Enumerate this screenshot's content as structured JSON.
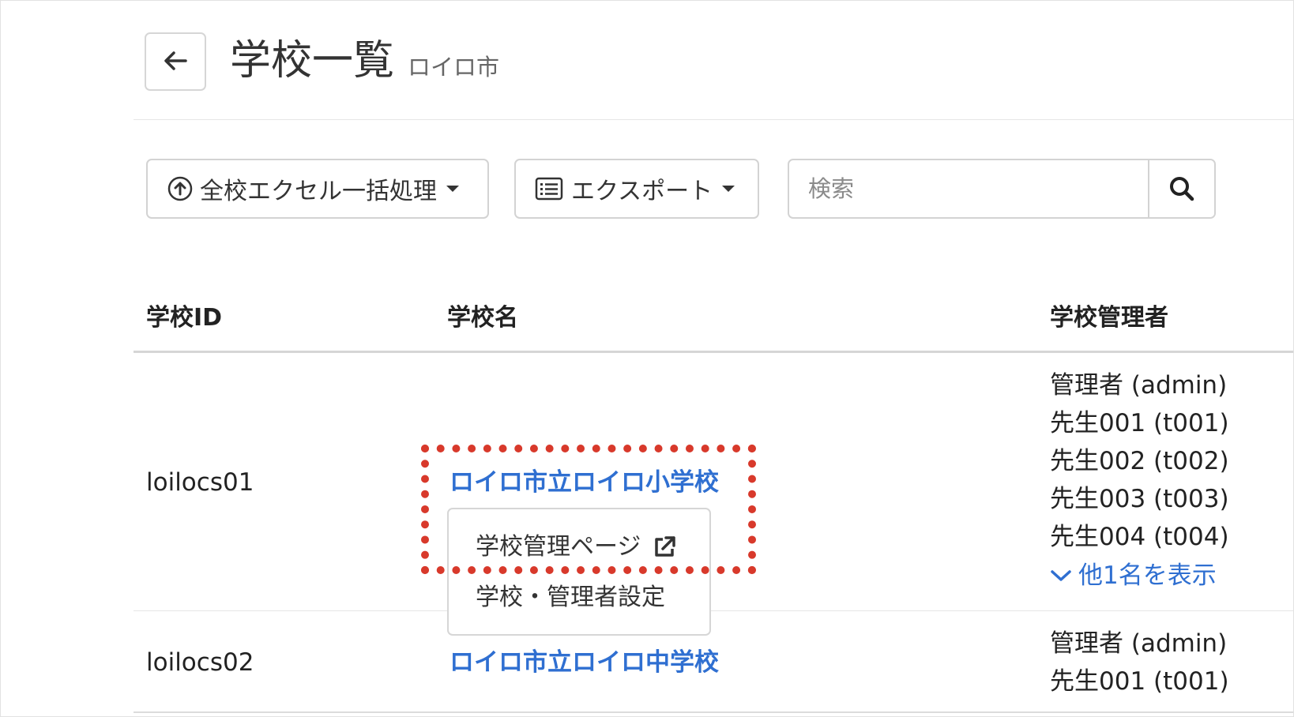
{
  "header": {
    "back_button_label": "",
    "title": "学校一覧",
    "subtitle": "ロイロ市"
  },
  "toolbar": {
    "bulk_excel_label": "全校エクセル一括処理",
    "export_label": "エクスポート",
    "search_placeholder": "検索"
  },
  "table": {
    "columns": {
      "school_id": "学校ID",
      "school_name": "学校名",
      "school_admins": "学校管理者"
    },
    "rows": [
      {
        "school_id": "loilocs01",
        "school_name": "ロイロ市立ロイロ小学校",
        "admins": [
          "管理者 (admin)",
          "先生001 (t001)",
          "先生002 (t002)",
          "先生003 (t003)",
          "先生004 (t004)"
        ],
        "show_more": "他1名を表示"
      },
      {
        "school_id": "loilocs02",
        "school_name": "ロイロ市立ロイロ中学校",
        "admins": [
          "管理者 (admin)",
          "先生001 (t001)"
        ]
      }
    ]
  },
  "dropdown_menu": {
    "items": [
      "学校管理ページ",
      "学校・管理者設定"
    ]
  },
  "colors": {
    "link": "#2f6fd1",
    "highlight": "#d8392b",
    "border": "#d3d3d3"
  },
  "icons": [
    "arrow-left-icon",
    "upload-circle-icon",
    "list-icon",
    "search-icon",
    "external-link-icon",
    "chevron-down-icon"
  ]
}
